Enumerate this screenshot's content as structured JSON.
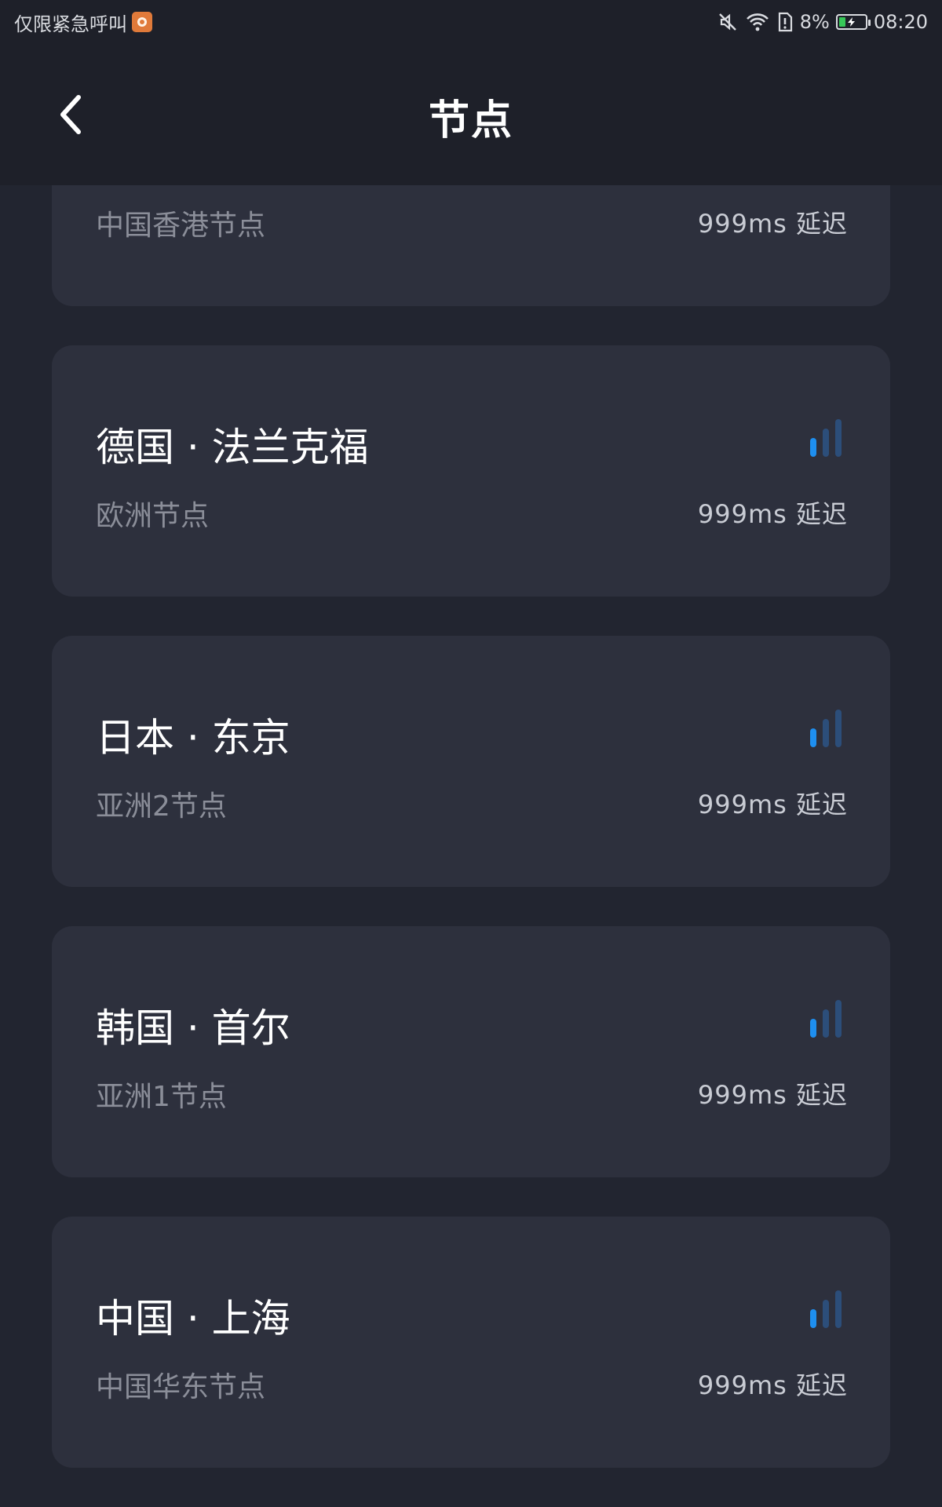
{
  "status_bar": {
    "left_text": "仅限紧急呼叫",
    "battery_percent": "8%",
    "battery_level": 0.08,
    "time": "08:20"
  },
  "header": {
    "title": "节点"
  },
  "nodes": [
    {
      "name": "",
      "region": "中国香港节点",
      "latency": "999ms 延迟"
    },
    {
      "name": "德国 · 法兰克福",
      "region": "欧洲节点",
      "latency": "999ms 延迟",
      "signal_bars": 1
    },
    {
      "name": "日本 · 东京",
      "region": "亚洲2节点",
      "latency": "999ms 延迟",
      "signal_bars": 1
    },
    {
      "name": "韩国 · 首尔",
      "region": "亚洲1节点",
      "latency": "999ms 延迟",
      "signal_bars": 1
    },
    {
      "name": "中国 · 上海",
      "region": "中国华东节点",
      "latency": "999ms 延迟",
      "signal_bars": 1
    }
  ],
  "colors": {
    "background": "#222530",
    "card": "#2d303d",
    "signal_active": "#1e8ff0",
    "signal_inactive": "#2c4e7a"
  }
}
